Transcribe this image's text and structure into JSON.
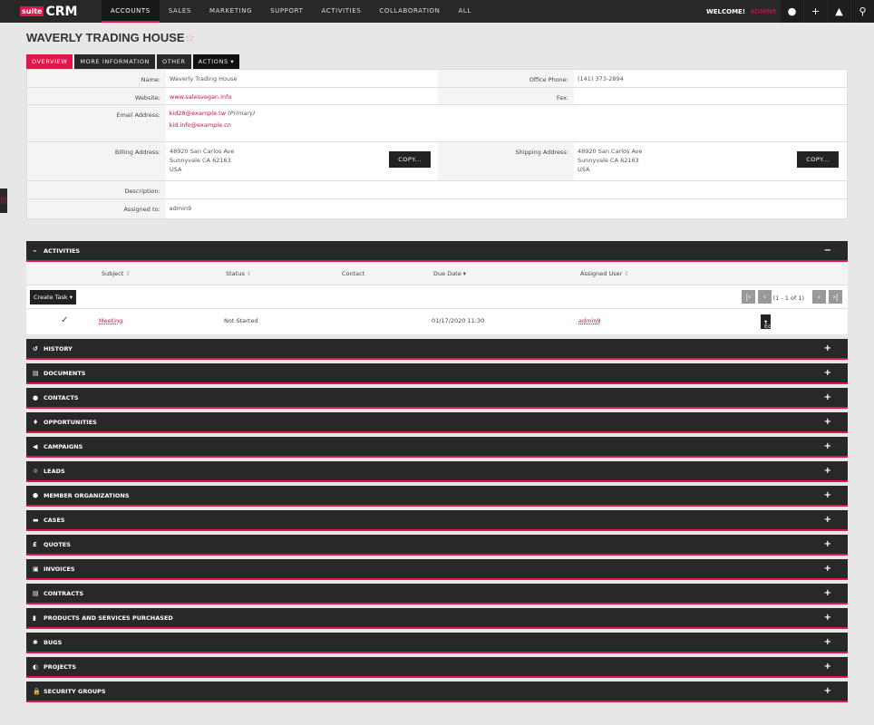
{
  "nav": {
    "logo_suite": "suite",
    "logo_crm": "CRM",
    "items": [
      "ACCOUNTS",
      "SALES",
      "MARKETING",
      "SUPPORT",
      "ACTIVITIES",
      "COLLABORATION",
      "ALL"
    ],
    "welcome": "WELCOME!",
    "user": "ADMIN9"
  },
  "title": "WAVERLY TRADING HOUSE",
  "tabs": [
    "OVERVIEW",
    "MORE INFORMATION",
    "OTHER",
    "ACTIONS"
  ],
  "detail": {
    "name_label": "Name:",
    "name": "Waverly Trading House",
    "phone_label": "Office Phone:",
    "phone": "(141) 373-2894",
    "website_label": "Website:",
    "website": "www.salesvegan.info",
    "fax_label": "Fax:",
    "email_label": "Email Address:",
    "email1": "kid28@example.tw",
    "email1_tag": "(Primary)",
    "email2": "kid.info@example.cn",
    "billing_label": "Billing Address:",
    "billing": [
      "48920 San Carlos Ave",
      "Sunnyvale CA   62163",
      "USA"
    ],
    "shipping_label": "Shipping Address:",
    "shipping": [
      "48920 San Carlos Ave",
      "Sunnyvale CA   62163",
      "USA"
    ],
    "copy": "COPY...",
    "description_label": "Description:",
    "assigned_label": "Assigned to:",
    "assigned": "admin9"
  },
  "activities": {
    "title": "ACTIVITIES",
    "columns": [
      "Subject",
      "Status",
      "Contact",
      "Due Date",
      "Assigned User"
    ],
    "create_task": "Create Task",
    "pagination": "(1 - 1 of 1)",
    "rows": [
      {
        "subject": "Meeting",
        "status": "Not Started",
        "contact": "",
        "due": "01/17/2020 11:30",
        "user": "admin9",
        "edit": "Edit"
      }
    ]
  },
  "subpanels": [
    "HISTORY",
    "DOCUMENTS",
    "CONTACTS",
    "OPPORTUNITIES",
    "CAMPAIGNS",
    "LEADS",
    "MEMBER ORGANIZATIONS",
    "CASES",
    "QUOTES",
    "INVOICES",
    "CONTRACTS",
    "PRODUCTS AND SERVICES PURCHASED",
    "BUGS",
    "PROJECTS",
    "SECURITY GROUPS"
  ],
  "colors": {
    "accent": "#e4154b",
    "bar": "#282828"
  }
}
